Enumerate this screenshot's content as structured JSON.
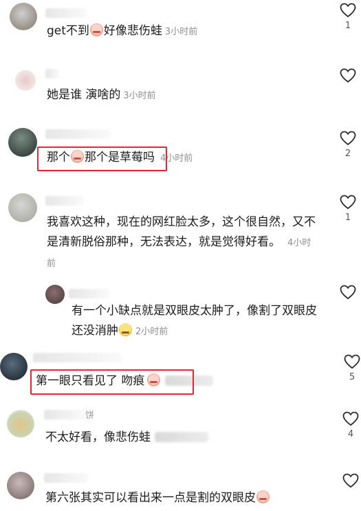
{
  "comments": [
    {
      "text": "get不到",
      "text_after": "好像悲伤蛙",
      "time": "3小时前",
      "likes": "1"
    },
    {
      "text": "她是谁 演啥的",
      "time": "3小时前",
      "likes": ""
    },
    {
      "text": "那个",
      "text_after": "那个是草莓吗",
      "time": "4小时前",
      "likes": "2"
    },
    {
      "text": "我喜欢这种，现在的网红脸太多，这个很自然，又不是清新脱俗那种，无法表达，就是觉得好看。",
      "time": "4小时前",
      "likes": "1"
    },
    {
      "text": "有一个小缺点就是双眼皮太肿了，像割了双眼皮还没消肿",
      "time": "2小时前",
      "likes": ""
    },
    {
      "text": "第一眼只看见了 吻痕",
      "likes": "5"
    },
    {
      "username_fragment": "饼",
      "text": "不太好看，像悲伤蛙",
      "likes": "4"
    },
    {
      "text": "第六张其实可以看出来一点是割的双眼皮",
      "likes": ""
    }
  ],
  "icons": {
    "like": "heart-outline-icon",
    "emoji_sad": "crying-face-emoji",
    "emoji_smile": "smiling-face-emoji"
  },
  "colors": {
    "highlight": "#e5262e",
    "time": "#8f8f8f"
  }
}
